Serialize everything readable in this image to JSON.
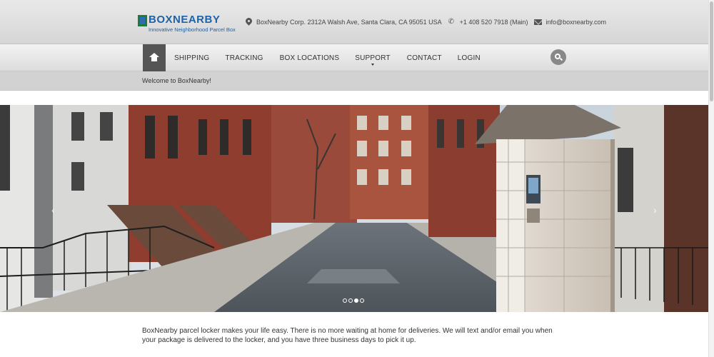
{
  "header": {
    "logo_name_prefix": "BOX",
    "logo_name_suffix": "NEARBY",
    "logo_tagline": "Innovative Neighborhood Parcel Box",
    "address": "BoxNearby Corp. 2312A Walsh Ave, Santa Clara, CA 95051 USA",
    "phone": "+1 408 520 7918 (Main)",
    "email": "info@boxnearby.com"
  },
  "nav": {
    "items": [
      {
        "label": "SHIPPING"
      },
      {
        "label": "TRACKING"
      },
      {
        "label": "BOX LOCATIONS"
      },
      {
        "label": "SUPPORT"
      },
      {
        "label": "CONTACT"
      },
      {
        "label": "LOGIN"
      }
    ]
  },
  "welcome": "Welcome to BoxNearby!",
  "carousel": {
    "slide_count": 4,
    "active_index": 2,
    "prev_glyph": "‹",
    "next_glyph": "›"
  },
  "intro_text": "BoxNearby parcel locker makes your life easy. There is no more waiting at home for deliveries. We will text and/or email you when your package is delivered to the locker, and you have three business days to pick it up.",
  "colors": {
    "brand_blue": "#1e63a8",
    "brand_green": "#1f7a3d",
    "nav_active": "#555555"
  }
}
